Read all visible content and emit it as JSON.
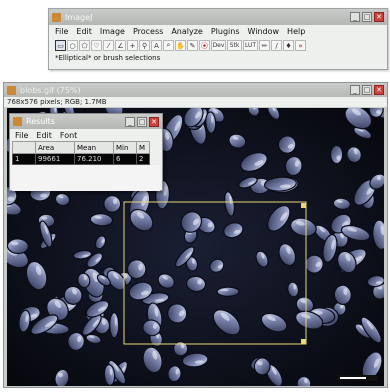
{
  "main_window": {
    "title": "ImageJ",
    "menu": [
      "File",
      "Edit",
      "Image",
      "Process",
      "Analyze",
      "Plugins",
      "Window",
      "Help"
    ],
    "tools": [
      "rectangle",
      "oval",
      "polygon",
      "freehand",
      "straight-line",
      "angle",
      "point",
      "wand",
      "text",
      "magnifier",
      "hand",
      "color-picker",
      "Dev",
      "Stk",
      "LUT",
      "pencil",
      "brush",
      "dropper",
      "more"
    ],
    "status": "*Elliptical* or brush selections"
  },
  "image_window": {
    "title": "blobs.gif (75%)",
    "info": "768x576 pixels; RGB; 1.7MB"
  },
  "results_window": {
    "title": "Results",
    "menu": [
      "File",
      "Edit",
      "Font"
    ],
    "columns": [
      "",
      "Area",
      "Mean",
      "Min",
      "M"
    ],
    "rows": [
      [
        "1",
        "99661",
        "76.210",
        "6",
        "2"
      ]
    ]
  }
}
